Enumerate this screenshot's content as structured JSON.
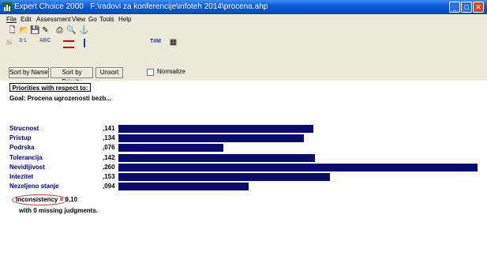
{
  "window": {
    "app_title": "Expert Choice 2000",
    "file_path": "F:\\radovi za konferencije\\infoteh 2014\\procena.ahp"
  },
  "menu": [
    "File",
    "Edit",
    "Assessment",
    "View",
    "Go",
    "Tools",
    "Help"
  ],
  "toolbar2": {
    "ratio_label": "3:1",
    "abc_label": "ABC",
    "ttl_label": "T#M"
  },
  "sortbar": {
    "sort_name": "Sort by Name",
    "sort_priority": "Sort by Priority",
    "unsort": "Unsort",
    "normalize": "Normalize",
    "normalize_checked": false
  },
  "panel": {
    "priorities_header": "Priorities with respect to:",
    "goal": "Goal: Procena ugrozenosti bezb..."
  },
  "chart_data": {
    "type": "bar",
    "categories": [
      "Strucnost",
      "Pristup",
      "Podrska",
      "Tolerancija",
      "Nevidljivost",
      "Intezitet",
      "Nezeljeno stanje"
    ],
    "values": [
      0.141,
      0.134,
      0.076,
      0.142,
      0.26,
      0.153,
      0.094
    ],
    "value_labels": [
      ",141",
      ",134",
      ",076",
      ",142",
      ",260",
      ",153",
      ",094"
    ],
    "bar_color": "#0b0b6e"
  },
  "inconsistency": "Inconsistency = 0,10",
  "missing": "with 0  missing judgments."
}
